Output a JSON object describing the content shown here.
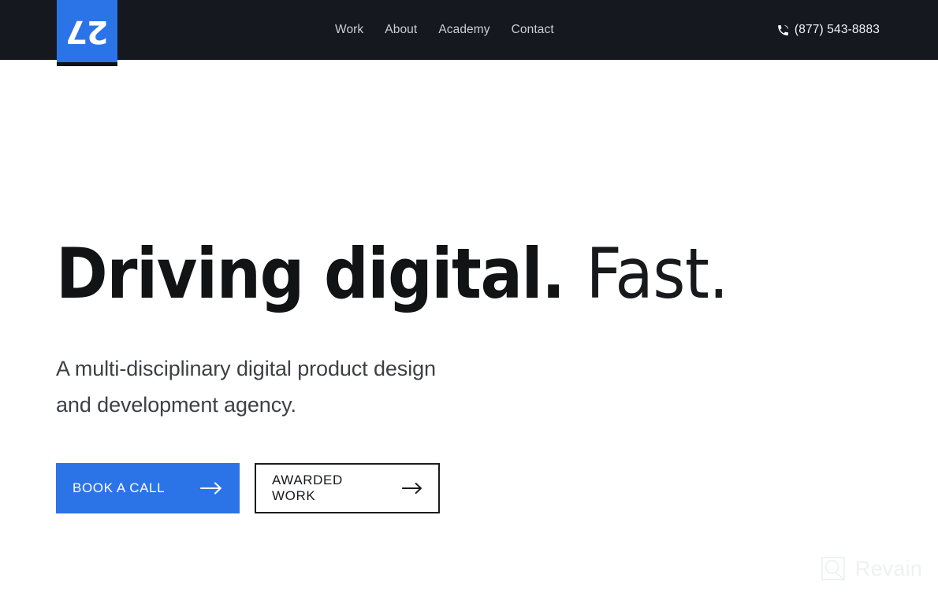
{
  "header": {
    "logo": {
      "name": "27-logo",
      "text": "27",
      "bg_color": "#2a74e8"
    },
    "nav": [
      {
        "label": "Work"
      },
      {
        "label": "About"
      },
      {
        "label": "Academy"
      },
      {
        "label": "Contact"
      }
    ],
    "phone": {
      "icon": "phone-icon",
      "number": "(877) 543-8883"
    },
    "bg_color": "#15181f"
  },
  "hero": {
    "headline_bold": "Driving digital.",
    "headline_light": "Fast.",
    "subheadline_line1": "A multi-disciplinary digital product design",
    "subheadline_line2": "and development agency.",
    "buttons": [
      {
        "label": "BOOK A CALL",
        "style": "primary",
        "icon": "arrow-right-icon",
        "bg_color": "#2a74e8"
      },
      {
        "label": "AWARDED WORK",
        "style": "outline",
        "icon": "arrow-right-icon",
        "border_color": "#1a1c1f"
      }
    ]
  },
  "watermark": {
    "label": "Revain",
    "icon": "revain-logo-icon",
    "color": "#eef0f2"
  }
}
